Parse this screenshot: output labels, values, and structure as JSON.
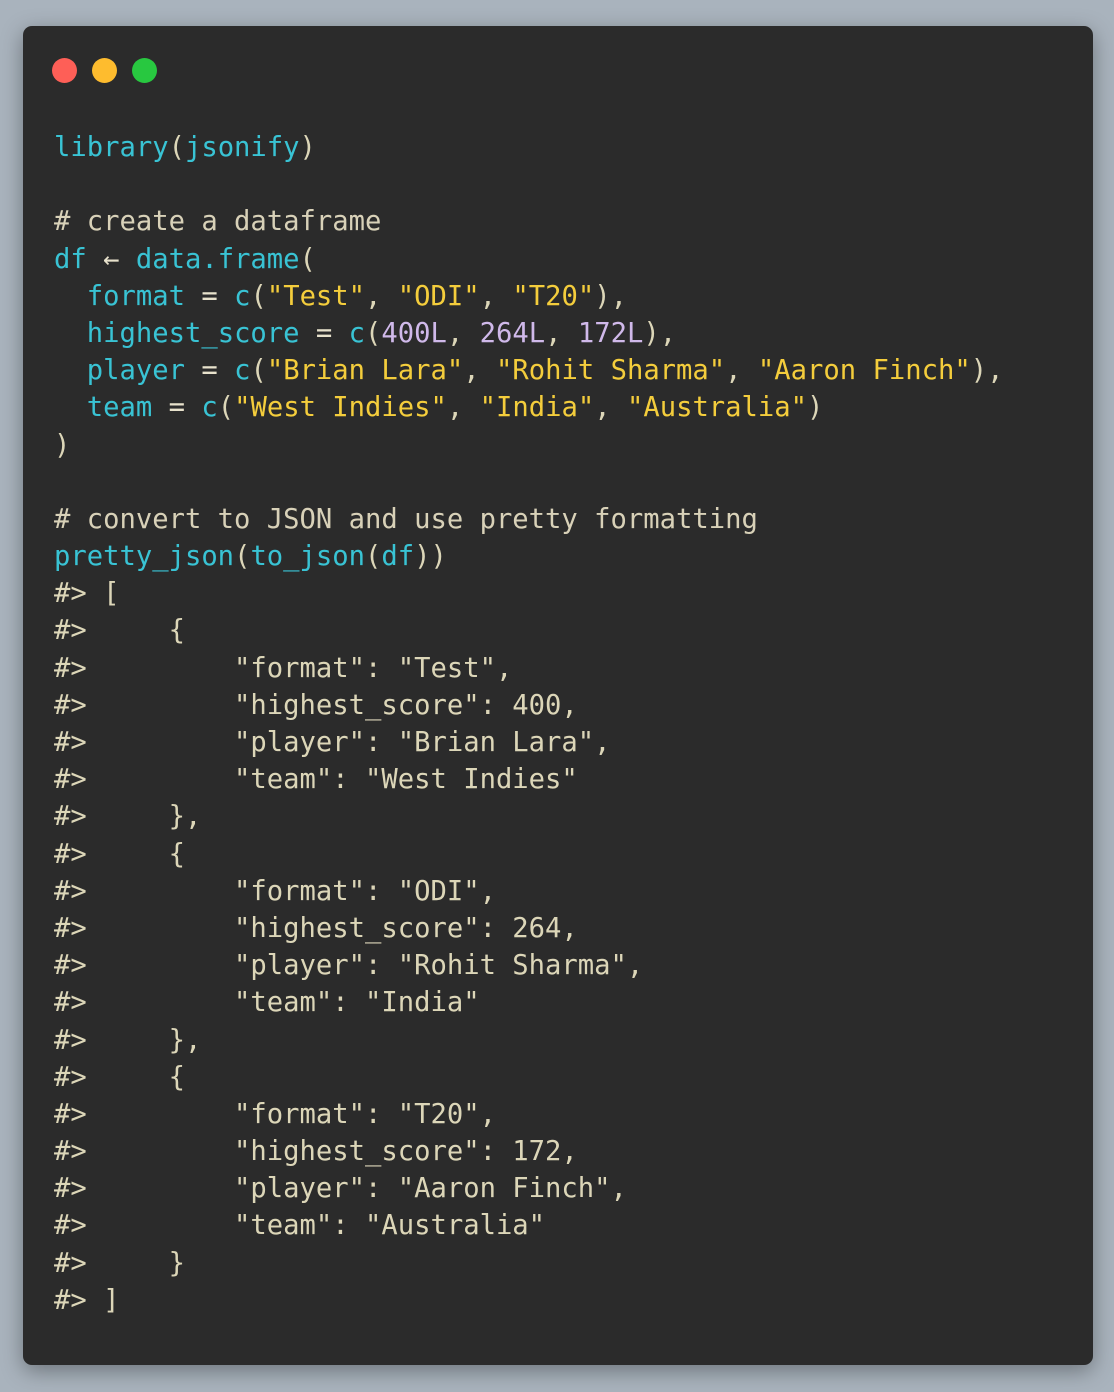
{
  "window": {
    "controls": [
      {
        "name": "close",
        "color": "#fe5f57"
      },
      {
        "name": "minimize",
        "color": "#febc2e"
      },
      {
        "name": "maximize",
        "color": "#28c840"
      }
    ]
  },
  "code": {
    "language": "R",
    "lines": [
      [
        {
          "t": "library",
          "k": "fn"
        },
        {
          "t": "(",
          "k": "plain"
        },
        {
          "t": "jsonify",
          "k": "var"
        },
        {
          "t": ")",
          "k": "plain"
        }
      ],
      [],
      [
        {
          "t": "# create a dataframe",
          "k": "comment"
        }
      ],
      [
        {
          "t": "df",
          "k": "var"
        },
        {
          "t": " ← ",
          "k": "op"
        },
        {
          "t": "data.frame",
          "k": "fn"
        },
        {
          "t": "(",
          "k": "plain"
        }
      ],
      [
        {
          "t": "  ",
          "k": "plain"
        },
        {
          "t": "format",
          "k": "arg"
        },
        {
          "t": " = ",
          "k": "op"
        },
        {
          "t": "c",
          "k": "fn"
        },
        {
          "t": "(",
          "k": "plain"
        },
        {
          "t": "\"Test\"",
          "k": "str"
        },
        {
          "t": ", ",
          "k": "plain"
        },
        {
          "t": "\"ODI\"",
          "k": "str"
        },
        {
          "t": ", ",
          "k": "plain"
        },
        {
          "t": "\"T20\"",
          "k": "str"
        },
        {
          "t": "),",
          "k": "plain"
        }
      ],
      [
        {
          "t": "  ",
          "k": "plain"
        },
        {
          "t": "highest_score",
          "k": "arg"
        },
        {
          "t": " = ",
          "k": "op"
        },
        {
          "t": "c",
          "k": "fn"
        },
        {
          "t": "(",
          "k": "plain"
        },
        {
          "t": "400L",
          "k": "num"
        },
        {
          "t": ", ",
          "k": "plain"
        },
        {
          "t": "264L",
          "k": "num"
        },
        {
          "t": ", ",
          "k": "plain"
        },
        {
          "t": "172L",
          "k": "num"
        },
        {
          "t": "),",
          "k": "plain"
        }
      ],
      [
        {
          "t": "  ",
          "k": "plain"
        },
        {
          "t": "player",
          "k": "arg"
        },
        {
          "t": " = ",
          "k": "op"
        },
        {
          "t": "c",
          "k": "fn"
        },
        {
          "t": "(",
          "k": "plain"
        },
        {
          "t": "\"Brian Lara\"",
          "k": "str"
        },
        {
          "t": ", ",
          "k": "plain"
        },
        {
          "t": "\"Rohit Sharma\"",
          "k": "str"
        },
        {
          "t": ", ",
          "k": "plain"
        },
        {
          "t": "\"Aaron Finch\"",
          "k": "str"
        },
        {
          "t": "),",
          "k": "plain"
        }
      ],
      [
        {
          "t": "  ",
          "k": "plain"
        },
        {
          "t": "team",
          "k": "arg"
        },
        {
          "t": " = ",
          "k": "op"
        },
        {
          "t": "c",
          "k": "fn"
        },
        {
          "t": "(",
          "k": "plain"
        },
        {
          "t": "\"West Indies\"",
          "k": "str"
        },
        {
          "t": ", ",
          "k": "plain"
        },
        {
          "t": "\"India\"",
          "k": "str"
        },
        {
          "t": ", ",
          "k": "plain"
        },
        {
          "t": "\"Australia\"",
          "k": "str"
        },
        {
          "t": ")",
          "k": "plain"
        }
      ],
      [
        {
          "t": ")",
          "k": "plain"
        }
      ],
      [],
      [
        {
          "t": "# convert to JSON and use pretty formatting",
          "k": "comment"
        }
      ],
      [
        {
          "t": "pretty_json",
          "k": "fn"
        },
        {
          "t": "(",
          "k": "plain"
        },
        {
          "t": "to_json",
          "k": "fn"
        },
        {
          "t": "(",
          "k": "plain"
        },
        {
          "t": "df",
          "k": "var"
        },
        {
          "t": "))",
          "k": "plain"
        }
      ],
      [
        {
          "t": "#> [",
          "k": "out"
        }
      ],
      [
        {
          "t": "#>     {",
          "k": "out"
        }
      ],
      [
        {
          "t": "#>         \"format\": \"Test\",",
          "k": "out"
        }
      ],
      [
        {
          "t": "#>         \"highest_score\": 400,",
          "k": "out"
        }
      ],
      [
        {
          "t": "#>         \"player\": \"Brian Lara\",",
          "k": "out"
        }
      ],
      [
        {
          "t": "#>         \"team\": \"West Indies\"",
          "k": "out"
        }
      ],
      [
        {
          "t": "#>     },",
          "k": "out"
        }
      ],
      [
        {
          "t": "#>     {",
          "k": "out"
        }
      ],
      [
        {
          "t": "#>         \"format\": \"ODI\",",
          "k": "out"
        }
      ],
      [
        {
          "t": "#>         \"highest_score\": 264,",
          "k": "out"
        }
      ],
      [
        {
          "t": "#>         \"player\": \"Rohit Sharma\",",
          "k": "out"
        }
      ],
      [
        {
          "t": "#>         \"team\": \"India\"",
          "k": "out"
        }
      ],
      [
        {
          "t": "#>     },",
          "k": "out"
        }
      ],
      [
        {
          "t": "#>     {",
          "k": "out"
        }
      ],
      [
        {
          "t": "#>         \"format\": \"T20\",",
          "k": "out"
        }
      ],
      [
        {
          "t": "#>         \"highest_score\": 172,",
          "k": "out"
        }
      ],
      [
        {
          "t": "#>         \"player\": \"Aaron Finch\",",
          "k": "out"
        }
      ],
      [
        {
          "t": "#>         \"team\": \"Australia\"",
          "k": "out"
        }
      ],
      [
        {
          "t": "#>     }",
          "k": "out"
        }
      ],
      [
        {
          "t": "#> ]",
          "k": "out"
        }
      ]
    ]
  }
}
